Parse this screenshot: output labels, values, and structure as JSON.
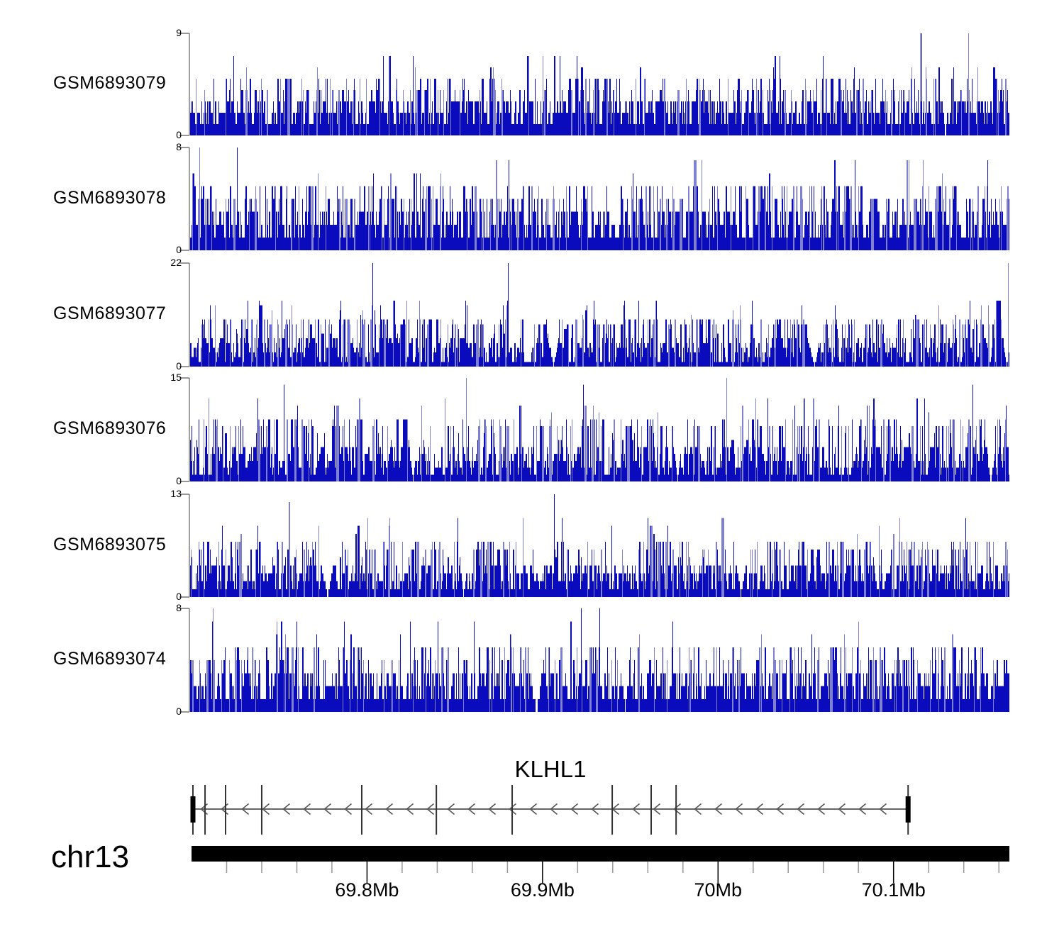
{
  "chart_data": {
    "type": "genome-coverage-tracks",
    "region": {
      "chromosome": "chr13",
      "view_start_mb": 69.7,
      "view_end_mb": 70.166
    },
    "signal_color": "#0b0bbe",
    "tracks": [
      {
        "label": "GSM6893079",
        "ymin": 0,
        "ymax": 9,
        "profile": {
          "base": 3,
          "mid": 4,
          "midP": 0.2,
          "tall": 6,
          "tallP": 0.03,
          "maxP": 0.0035,
          "gapRate": 0.0015,
          "max_peak_x_frac": 0.95
        }
      },
      {
        "label": "GSM6893078",
        "ymin": 0,
        "ymax": 8,
        "profile": {
          "base": 3,
          "mid": 4,
          "midP": 0.24,
          "tall": 6,
          "tallP": 0.022,
          "maxP": 0.0035,
          "gapRate": 0.0015,
          "max_peak_x_frac": 0.012
        }
      },
      {
        "label": "GSM6893077",
        "ymin": 0,
        "ymax": 22,
        "profile": {
          "base": 6,
          "mid": 9,
          "midP": 0.26,
          "tall": 13,
          "tallP": 0.035,
          "maxP": 0.0025,
          "gapRate": 0.005,
          "max_peak_x_frac": 0.999
        }
      },
      {
        "label": "GSM6893076",
        "ymin": 0,
        "ymax": 15,
        "profile": {
          "base": 5,
          "mid": 8,
          "midP": 0.22,
          "tall": 11,
          "tallP": 0.03,
          "maxP": 0.003,
          "gapRate": 0.006,
          "max_peak_x_frac": 0.337
        }
      },
      {
        "label": "GSM6893075",
        "ymin": 0,
        "ymax": 13,
        "profile": {
          "base": 4,
          "mid": 6,
          "midP": 0.22,
          "tall": 9,
          "tallP": 0.03,
          "maxP": 0.0025,
          "gapRate": 0.005,
          "max_peak_x_frac": 0.445
        }
      },
      {
        "label": "GSM6893074",
        "ymin": 0,
        "ymax": 8,
        "profile": {
          "base": 3,
          "mid": 4,
          "midP": 0.24,
          "tall": 6,
          "tallP": 0.025,
          "maxP": 0.0035,
          "gapRate": 0.0025,
          "max_peak_x_frac": 0.5
        }
      }
    ],
    "gene": {
      "name": "KLHL1",
      "strand": "-",
      "start_mb": 69.7008,
      "end_mb": 70.1083,
      "exon_mb": [
        69.7008,
        69.7077,
        69.7194,
        69.74,
        69.797,
        69.8395,
        69.8827,
        69.9397,
        69.9619,
        69.9761,
        70.1083
      ]
    },
    "ruler": {
      "chromosome_label": "chr13",
      "minor_tick_interval_mb": 0.02,
      "major_ticks": [
        {
          "mb": 69.8,
          "label": "69.8Mb"
        },
        {
          "mb": 69.9,
          "label": "69.9Mb"
        },
        {
          "mb": 70.0,
          "label": "70Mb"
        },
        {
          "mb": 70.1,
          "label": "70.1Mb"
        }
      ]
    }
  }
}
